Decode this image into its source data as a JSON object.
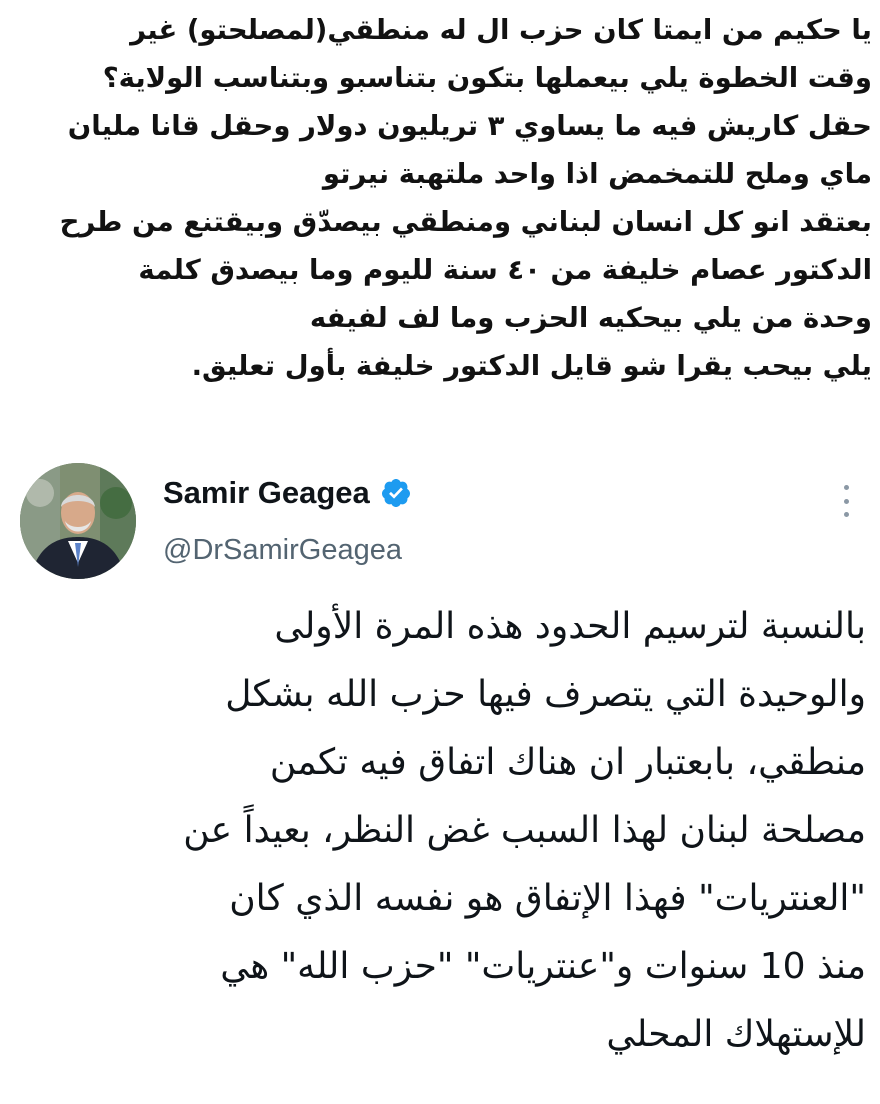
{
  "caption": {
    "lines": [
      "يا حكيم من ايمتا كان حزب ال له منطقي(لمصلحتو) غير",
      "وقت الخطوة يلي بيعملها بتكون بتناسبو وبتناسب الولاية؟",
      "حقل كاريش فيه ما يساوي ٣ تريليون دولار وحقل قانا مليان",
      "ماي وملح للتمخمض اذا واحد ملتهبة نيرتو",
      "بعتقد انو كل انسان لبناني ومنطقي بيصدّق وبيقتنع من طرح",
      "الدكتور عصام خليفة من ٤٠ سنة لليوم وما بيصدق كلمة",
      "وحدة من يلي بيحكيه الحزب وما لف لفيفه",
      "يلي بيحب يقرا شو قايل الدكتور خليفة بأول تعليق."
    ]
  },
  "tweet": {
    "display_name": "Samir Geagea",
    "handle": "@DrSamirGeagea",
    "verified_color": "#1d9bf0",
    "avatar_icon": "profile-photo",
    "more_icon": "vertical-ellipsis-icon",
    "body_lines": [
      "بالنسبة لترسيم الحدود هذه المرة الأولى",
      "والوحيدة التي يتصرف فيها حزب الله بشكل",
      "منطقي، بابعتبار ان هناك اتفاق فيه تكمن",
      "مصلحة لبنان لهذا السبب غض النظر، بعيداً عن",
      "\"العنتريات\" فهذا الإتفاق هو نفسه الذي كان",
      "منذ 10 سنوات و\"عنتريات\" \"حزب الله\" هي",
      "للإستهلاك المحلي"
    ]
  }
}
